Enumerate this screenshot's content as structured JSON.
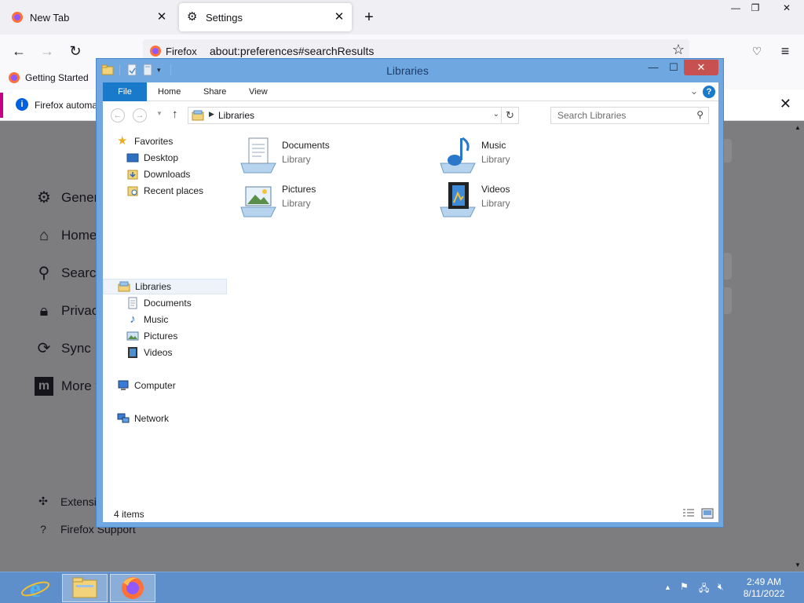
{
  "browser": {
    "tabs": [
      {
        "label": "New Tab"
      },
      {
        "label": "Settings"
      }
    ],
    "identity_label": "Firefox",
    "url": "about:preferences#searchResults",
    "bookmark": "Getting Started",
    "notice": "Firefox automa",
    "sidebar": [
      "Genera",
      "Home",
      "Search",
      "Privacy",
      "Sync",
      "More f"
    ],
    "sidebar_bottom": [
      "Extensio",
      "Firefox Support"
    ]
  },
  "explorer": {
    "title": "Libraries",
    "ribbon_tabs": [
      "File",
      "Home",
      "Share",
      "View"
    ],
    "address": "Libraries",
    "search_placeholder": "Search Libraries",
    "nav": {
      "favorites": "Favorites",
      "favorite_items": [
        "Desktop",
        "Downloads",
        "Recent places"
      ],
      "libraries": "Libraries",
      "library_items": [
        "Documents",
        "Music",
        "Pictures",
        "Videos"
      ],
      "computer": "Computer",
      "network": "Network"
    },
    "items": [
      {
        "name": "Documents",
        "type": "Library"
      },
      {
        "name": "Music",
        "type": "Library"
      },
      {
        "name": "Pictures",
        "type": "Library"
      },
      {
        "name": "Videos",
        "type": "Library"
      }
    ],
    "status": "4 items"
  },
  "taskbar": {
    "time": "2:49 AM",
    "date": "8/11/2022"
  }
}
